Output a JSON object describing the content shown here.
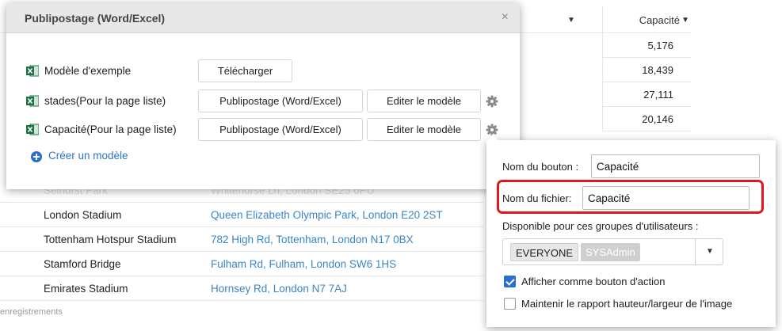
{
  "table": {
    "capacity_header": "Capacité",
    "capacities": [
      "5,176",
      "18,439",
      "27,111",
      "20,146"
    ],
    "rows": [
      {
        "name": "Selhurst Park",
        "address": "Whitehorse Ln, London SE25 6PU"
      },
      {
        "name": "London Stadium",
        "address": "Queen Elizabeth Olympic Park, London E20 2ST"
      },
      {
        "name": "Tottenham Hotspur Stadium",
        "address": "782 High Rd, Tottenham, London N17 0BX"
      },
      {
        "name": "Stamford Bridge",
        "address": "Fulham Rd, Fulham, London SW6 1HS"
      },
      {
        "name": "Emirates Stadium",
        "address": "Hornsey Rd, London N7 7AJ"
      }
    ],
    "footer": "enregistrements"
  },
  "modal": {
    "title": "Publipostage (Word/Excel)",
    "close_glyph": "×",
    "templates": [
      {
        "label": "Modèle d'exemple",
        "download_label": "Télécharger"
      },
      {
        "label": "stades(Pour la page liste)",
        "merge_label": "Publipostage (Word/Excel)",
        "edit_label": "Editer le modèle"
      },
      {
        "label": "Capacité(Pour la page liste)",
        "merge_label": "Publipostage (Word/Excel)",
        "edit_label": "Editer le modèle"
      }
    ],
    "create_label": "Créer un modèle"
  },
  "popover": {
    "button_name_label": "Nom du bouton :",
    "button_name_value": "Capacité",
    "file_name_label": "Nom du fichier:",
    "file_name_value": "Capacité",
    "groups_label": "Disponible pour ces groupes d'utilisateurs :",
    "groups": [
      "EVERYONE",
      "SYSAdmin"
    ],
    "show_action_label": "Afficher comme bouton d'action",
    "show_action_checked": true,
    "keep_ratio_label": "Maintenir le rapport hauteur/largeur de l'image",
    "keep_ratio_checked": false
  },
  "colors": {
    "link": "#3a86c8",
    "excel_green": "#1d7245",
    "accent_blue": "#2a6fcf",
    "highlight_red": "#e0171f"
  }
}
